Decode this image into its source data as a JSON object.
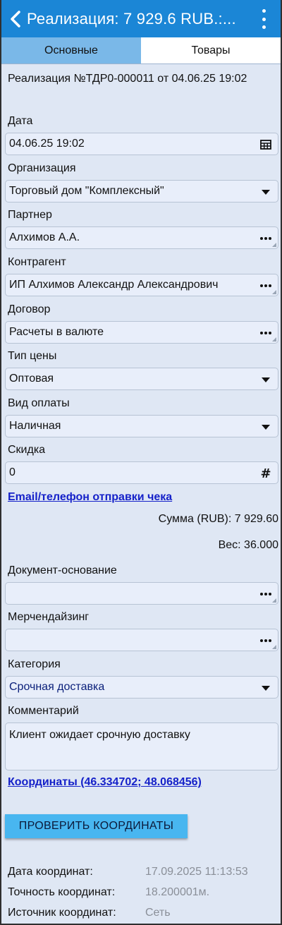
{
  "appbar": {
    "title": "Реализация: 7 929.6 RUB.:..."
  },
  "tabs": [
    {
      "label": "Основные",
      "active": true
    },
    {
      "label": "Товары",
      "active": false
    }
  ],
  "document": {
    "title": "Реализация №ТДР0-000011 от 04.06.25 19:02"
  },
  "fields": {
    "date": {
      "label": "Дата",
      "value": "04.06.25 19:02",
      "icon": "calendar-grid-icon"
    },
    "organization": {
      "label": "Организация",
      "value": "Торговый дом \"Комплексный\"",
      "icon": "dropdown-arrow-icon"
    },
    "partner": {
      "label": "Партнер",
      "value": "Алхимов А.А.",
      "icon": "more-dots-icon"
    },
    "counterparty": {
      "label": "Контрагент",
      "value": "ИП Алхимов Александр Александрович",
      "icon": "more-dots-icon"
    },
    "contract": {
      "label": "Договор",
      "value": "Расчеты в валюте",
      "icon": "more-dots-icon"
    },
    "price_type": {
      "label": "Тип цены",
      "value": "Оптовая",
      "icon": "dropdown-arrow-icon"
    },
    "payment_type": {
      "label": "Вид оплаты",
      "value": "Наличная",
      "icon": "dropdown-arrow-icon"
    },
    "discount": {
      "label": "Скидка",
      "value": "0",
      "icon": "hash-icon"
    },
    "base_document": {
      "label": "Документ-основание",
      "value": "",
      "icon": "more-dots-icon"
    },
    "merchandising": {
      "label": "Мерчендайзинг",
      "value": "",
      "icon": "more-dots-icon"
    },
    "category": {
      "label": "Категория",
      "value": "Срочная доставка",
      "icon": "dropdown-arrow-icon"
    },
    "comment": {
      "label": "Комментарий",
      "value": "Клиент ожидает срочную доставку"
    }
  },
  "receipt_link": "Email/телефон отправки чека",
  "totals": {
    "sum": "Сумма (RUB): 7 929.60",
    "weight": "Вес: 36.000"
  },
  "coordinates_link": "Координаты (46.334702; 48.068456)",
  "check_button": "ПРОВЕРИТЬ КООРДИНАТЫ",
  "coord_info": [
    {
      "label": "Дата координат:",
      "value": "17.09.2025 11:13:53"
    },
    {
      "label": "Точность координат:",
      "value": "18.200001м."
    },
    {
      "label": "Источник координат:",
      "value": "Сеть"
    }
  ],
  "colors": {
    "appbar": "#1b86d6",
    "tab_active": "#7ab8e8",
    "background": "#dfe7f4",
    "link": "#1521c9",
    "button": "#48b6f0"
  }
}
